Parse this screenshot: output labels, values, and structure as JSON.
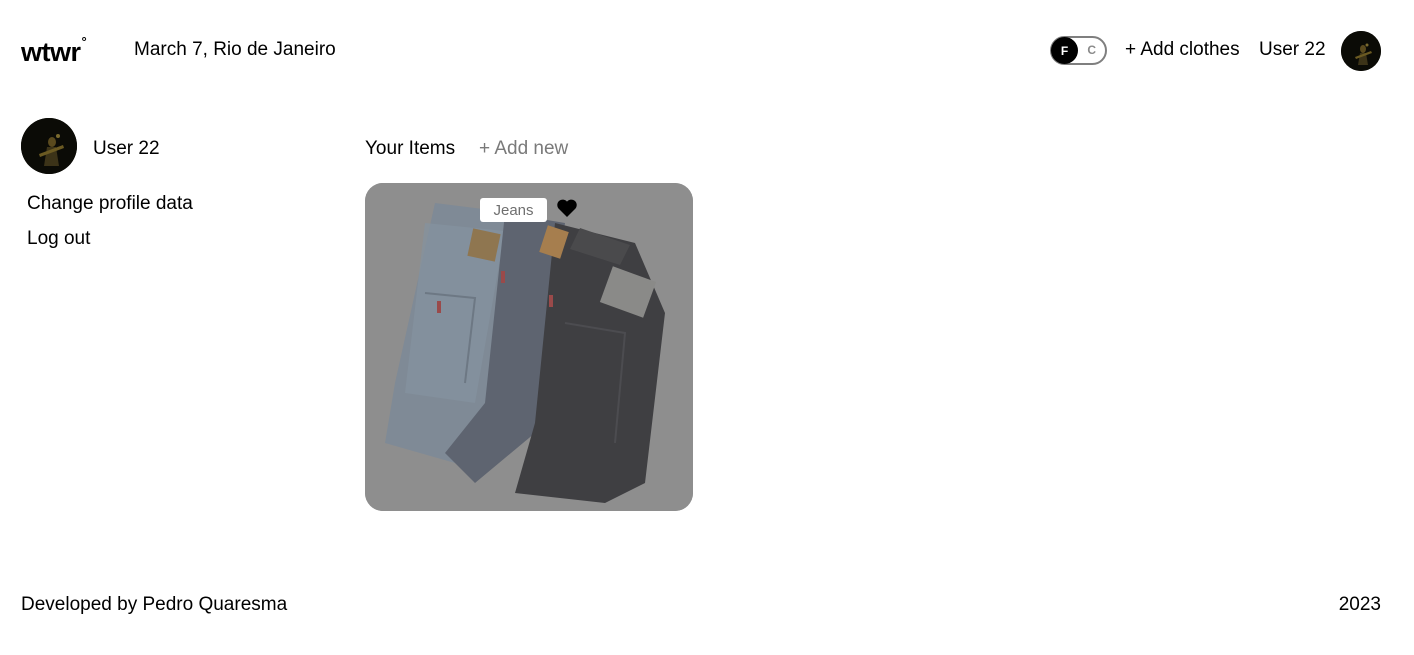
{
  "header": {
    "logo": "wtwr",
    "logo_mark": "°",
    "date_location": "March 7, Rio de Janeiro",
    "temp_toggle": {
      "on_label": "F",
      "off_label": "C",
      "selected": "F"
    },
    "add_clothes_label": "+ Add clothes",
    "user_name": "User 22"
  },
  "sidebar": {
    "user_name": "User 22",
    "links": [
      "Change profile data",
      "Log out"
    ]
  },
  "main": {
    "title": "Your Items",
    "add_new_label": "+ Add new",
    "items": [
      {
        "name": "Jeans",
        "liked": true,
        "image": "jeans-photo"
      }
    ]
  },
  "footer": {
    "developer": "Developed by Pedro Quaresma",
    "year": "2023"
  },
  "colors": {
    "text": "#000000",
    "muted": "#7a7a7a",
    "card_overlay": "#8c8c8c",
    "background": "#ffffff"
  }
}
